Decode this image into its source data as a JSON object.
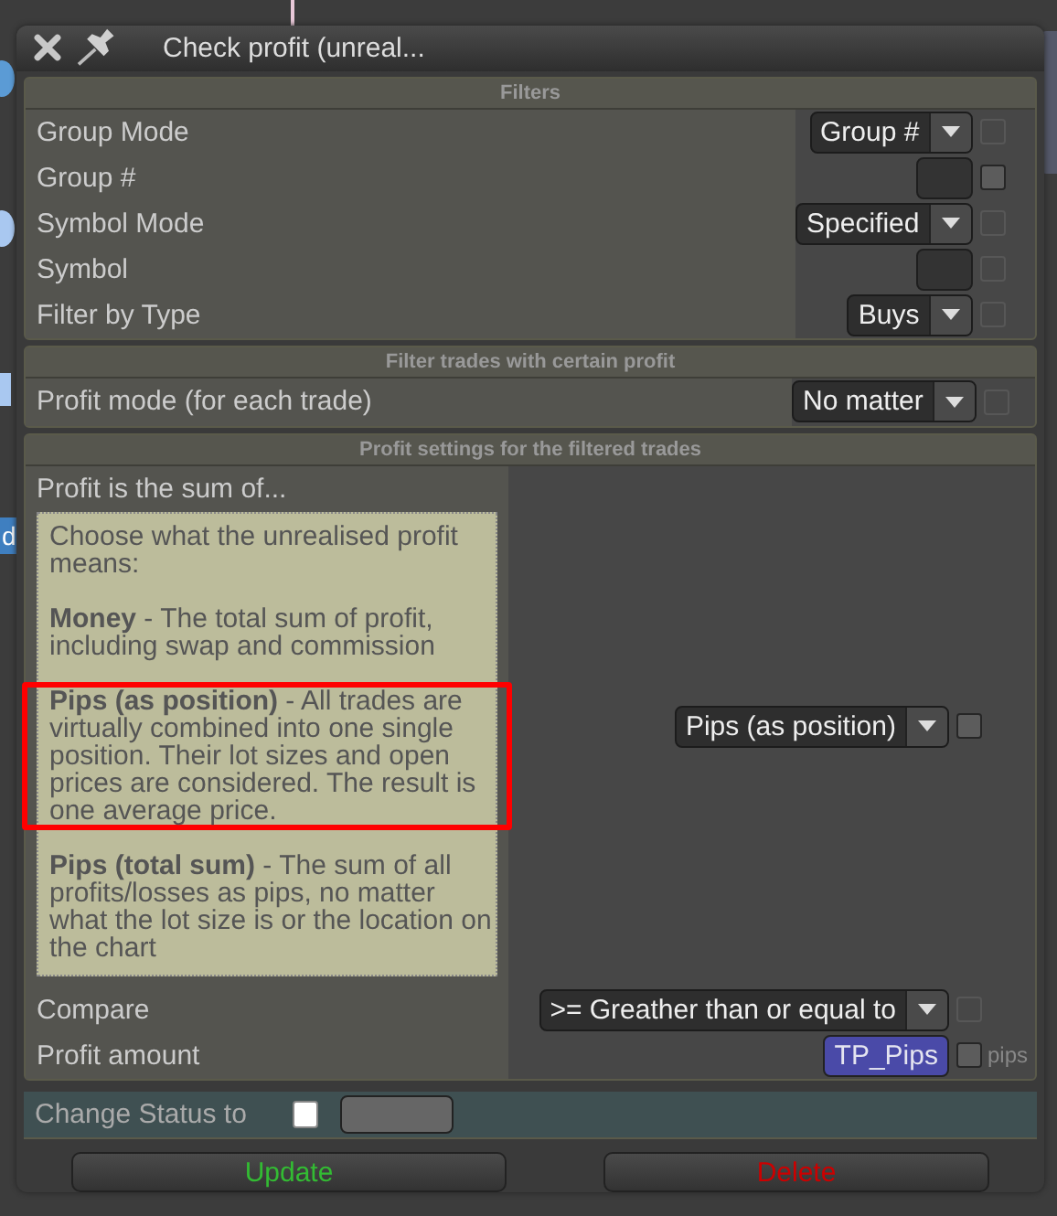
{
  "backdrop": {
    "node_label": "d"
  },
  "window": {
    "title": "Check profit (unreal..."
  },
  "sections": [
    {
      "title": "Filters",
      "rows": [
        {
          "label": "Group Mode",
          "control": {
            "kind": "dropdown",
            "value": "Group #"
          },
          "checkbox_enabled": false
        },
        {
          "label": "Group #",
          "control": {
            "kind": "field"
          },
          "checkbox_enabled": true
        },
        {
          "label": "Symbol Mode",
          "control": {
            "kind": "dropdown",
            "value": "Specified"
          },
          "checkbox_enabled": false
        },
        {
          "label": "Symbol",
          "control": {
            "kind": "field"
          },
          "checkbox_enabled": false
        },
        {
          "label": "Filter by Type",
          "control": {
            "kind": "dropdown",
            "value": "Buys"
          },
          "checkbox_enabled": false
        }
      ]
    },
    {
      "title": "Filter trades with certain profit",
      "rows": [
        {
          "label": "Profit mode (for each trade)",
          "control": {
            "kind": "dropdown",
            "value": "No matter"
          },
          "checkbox_enabled": false
        }
      ]
    },
    {
      "title": "Profit settings for the filtered trades",
      "rows": [
        {
          "label": "Profit is the sum of...",
          "description": [
            {
              "text": "Choose what the unrealised profit means:",
              "highlighted": false
            },
            {
              "text": "**Money** - The total sum of profit, including swap and commission",
              "highlighted": false
            },
            {
              "text": "**Pips (as position)** - All trades are virtually combined into one single position. Their lot sizes and open prices are considered. The result is one average price.",
              "highlighted": true
            },
            {
              "text": "**Pips (total sum)** - The sum of all profits/losses as pips, no matter what the lot size is or the location on the chart",
              "highlighted": false
            }
          ],
          "control": {
            "kind": "dropdown",
            "value": "Pips (as position)"
          },
          "checkbox_enabled": true
        },
        {
          "label": "Compare",
          "control": {
            "kind": "dropdown",
            "value": ">= Greather than or equal to"
          },
          "checkbox_enabled": false
        },
        {
          "label": "Profit amount",
          "control": {
            "kind": "variable",
            "value": "TP_Pips"
          },
          "checkbox_enabled": true,
          "unit": "pips"
        }
      ]
    }
  ],
  "status": {
    "label": "Change Status to",
    "checked": false
  },
  "buttons": [
    {
      "label": "Update",
      "color": "#33bb33"
    },
    {
      "label": "Delete",
      "color": "#cc0000"
    }
  ]
}
